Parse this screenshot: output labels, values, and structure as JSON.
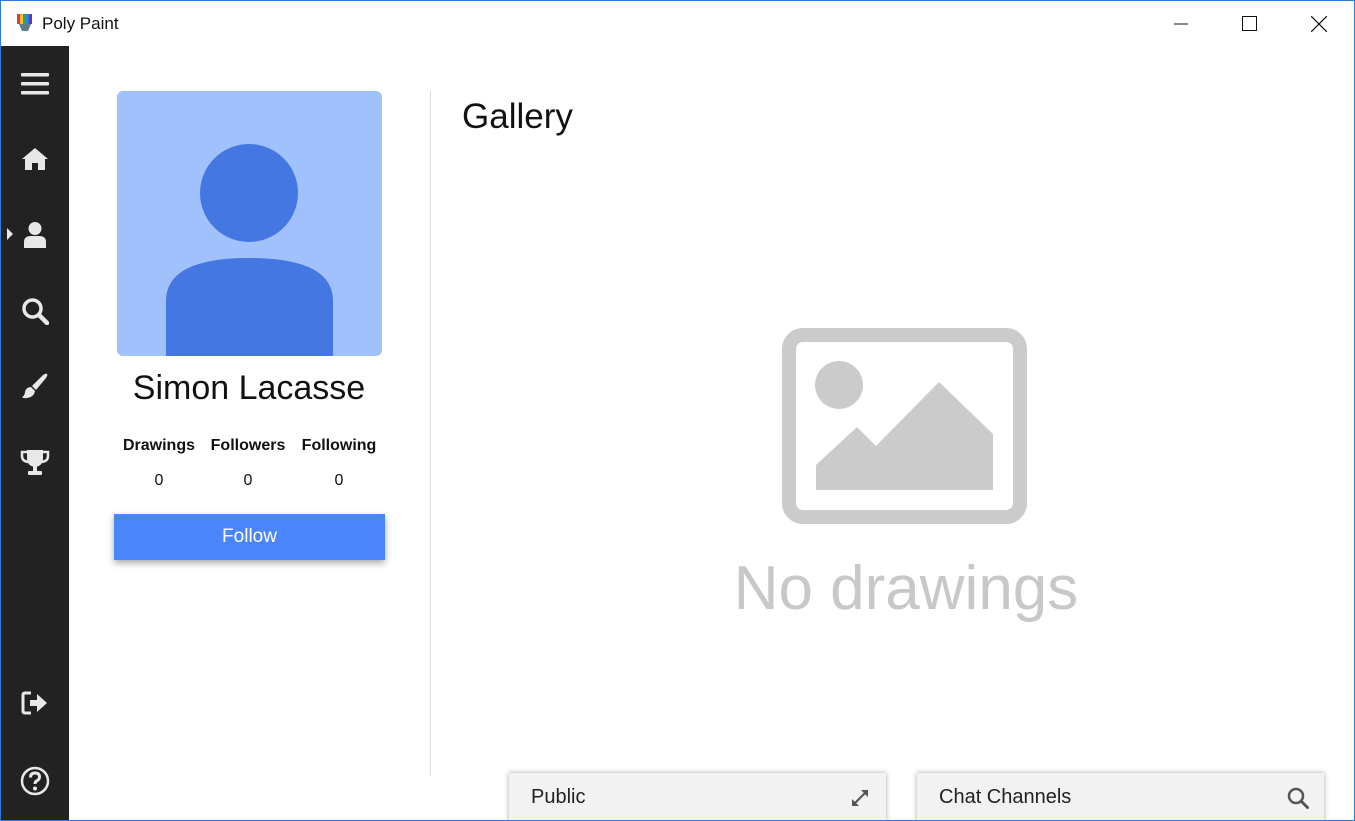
{
  "window": {
    "title": "Poly Paint",
    "accent_color": "#2b7bd8"
  },
  "sidebar": {
    "background": "#222222",
    "items": [
      {
        "icon": "menu-icon"
      },
      {
        "icon": "home-icon"
      },
      {
        "icon": "user-icon",
        "active": true
      },
      {
        "icon": "search-icon"
      },
      {
        "icon": "brush-icon"
      },
      {
        "icon": "trophy-icon"
      },
      {
        "icon": "logout-icon"
      },
      {
        "icon": "help-icon"
      }
    ]
  },
  "profile": {
    "name": "Simon Lacasse",
    "avatar_bg": "#a0c1fc",
    "avatar_fg": "#4477e2",
    "stats": [
      {
        "label": "Drawings",
        "value": "0"
      },
      {
        "label": "Followers",
        "value": "0"
      },
      {
        "label": "Following",
        "value": "0"
      }
    ],
    "follow_label": "Follow",
    "follow_color": "#4a86fb"
  },
  "gallery": {
    "title": "Gallery",
    "empty_text": "No drawings",
    "empty_icon": "image-placeholder-icon"
  },
  "chat": {
    "public_label": "Public",
    "public_icon": "expand-icon",
    "channels_label": "Chat Channels",
    "channels_icon": "search-icon"
  }
}
